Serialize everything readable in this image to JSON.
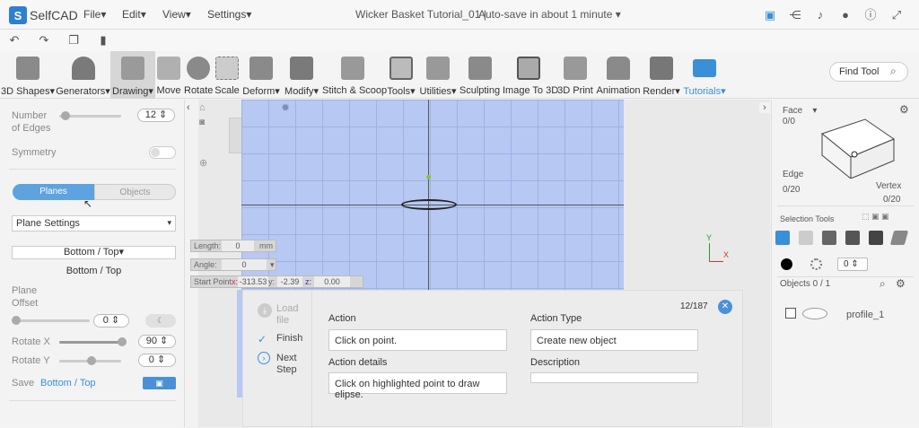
{
  "app": {
    "name": "SelfCAD",
    "title": "Wicker Basket Tutorial_01",
    "autosave": "Auto-save in about 1 minute"
  },
  "menus": [
    "File",
    "Edit",
    "View",
    "Settings"
  ],
  "toolbar": [
    {
      "label": "3D Shapes"
    },
    {
      "label": "Generators"
    },
    {
      "label": "Drawing"
    },
    {
      "label": "Move"
    },
    {
      "label": "Rotate"
    },
    {
      "label": "Scale"
    },
    {
      "label": "Deform"
    },
    {
      "label": "Modify"
    },
    {
      "label": "Stitch & Scoop"
    },
    {
      "label": "Tools"
    },
    {
      "label": "Utilities"
    },
    {
      "label": "Sculpting"
    },
    {
      "label": "Image To 3D"
    },
    {
      "label": "3D Print"
    },
    {
      "label": "Animation"
    },
    {
      "label": "Render"
    },
    {
      "label": "Tutorials"
    }
  ],
  "find_tool": "Find Tool",
  "left": {
    "number_of_edges": "Number\nof Edges",
    "edges_value": "12",
    "symmetry": "Symmetry",
    "tab_planes": "Planes",
    "tab_objects": "Objects",
    "plane_settings": "Plane Settings",
    "plane_select": "Bottom / Top",
    "plane_name": "Bottom / Top",
    "plane_offset": "Plane\nOffset",
    "offset_value": "0",
    "rotate_x": "Rotate X",
    "rotate_x_value": "90",
    "rotate_y": "Rotate Y",
    "rotate_y_value": "0",
    "save_label": "Save",
    "save_target": "Bottom / Top"
  },
  "viewport": {
    "length_label": "Length:",
    "length_value": "0",
    "length_unit": "mm",
    "angle_label": "Angle:",
    "angle_value": "0",
    "start_label": "Start Point",
    "start_x_label": "x:",
    "start_x": "-313.53",
    "start_y_label": "y:",
    "start_y": "-2.39",
    "start_z_label": "z:",
    "start_z": "0.00",
    "axis_x": "X",
    "axis_y": "Y"
  },
  "tutorial": {
    "step_count": "12/187",
    "load_file": "Load\nfile",
    "finish": "Finish",
    "next_step": "Next\nStep",
    "action_label": "Action",
    "action_value": "Click on point.",
    "action_type_label": "Action Type",
    "action_type_value": "Create new object",
    "action_details_label": "Action details",
    "action_details_value": "Click on highlighted point to draw elipse.",
    "description_label": "Description",
    "description_value": ""
  },
  "right": {
    "face_label": "Face",
    "face_count": "0/0",
    "edge_label": "Edge",
    "edge_count": "0/20",
    "vertex_label": "Vertex",
    "vertex_count": "0/20",
    "selection_tools": "Selection Tools",
    "brush_value": "0",
    "objects_label": "Objects 0 / 1",
    "object_name": "profile_1"
  }
}
